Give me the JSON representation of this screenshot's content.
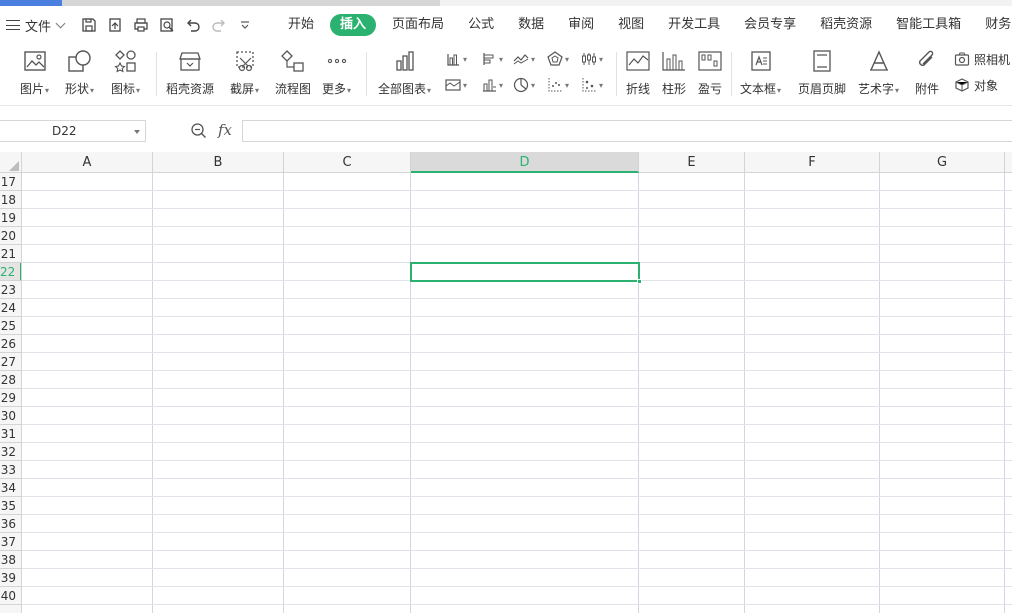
{
  "menubar": {
    "file_label": "文件",
    "tabs": [
      "开始",
      "插入",
      "页面布局",
      "公式",
      "数据",
      "审阅",
      "视图",
      "开发工具",
      "会员专享",
      "稻壳资源",
      "智能工具箱",
      "财务工具"
    ],
    "active_tab": "插入"
  },
  "ribbon": {
    "picture": "图片",
    "shape": "形状",
    "icon": "图标",
    "docer": "稻壳资源",
    "screenshot": "截屏",
    "flowchart": "流程图",
    "more": "更多",
    "all_charts": "全部图表",
    "line_spark": "折线",
    "column_spark": "柱形",
    "winloss_spark": "盈亏",
    "textbox": "文本框",
    "header_footer": "页眉页脚",
    "wordart": "艺术字",
    "attachment": "附件",
    "camera": "照相机",
    "object": "对象"
  },
  "formula": {
    "name_box": "D22",
    "fx_label": "fx",
    "value": ""
  },
  "grid": {
    "columns": [
      "A",
      "B",
      "C",
      "D",
      "E",
      "F",
      "G"
    ],
    "rows": [
      "17",
      "18",
      "19",
      "20",
      "21",
      "22",
      "23",
      "24",
      "25",
      "26",
      "27",
      "28",
      "29",
      "30",
      "31",
      "32",
      "33",
      "34",
      "35",
      "36",
      "37",
      "38",
      "39",
      "40"
    ],
    "selected_column": "D",
    "selected_row": "22"
  },
  "colors": {
    "accent": "#2cb270"
  }
}
